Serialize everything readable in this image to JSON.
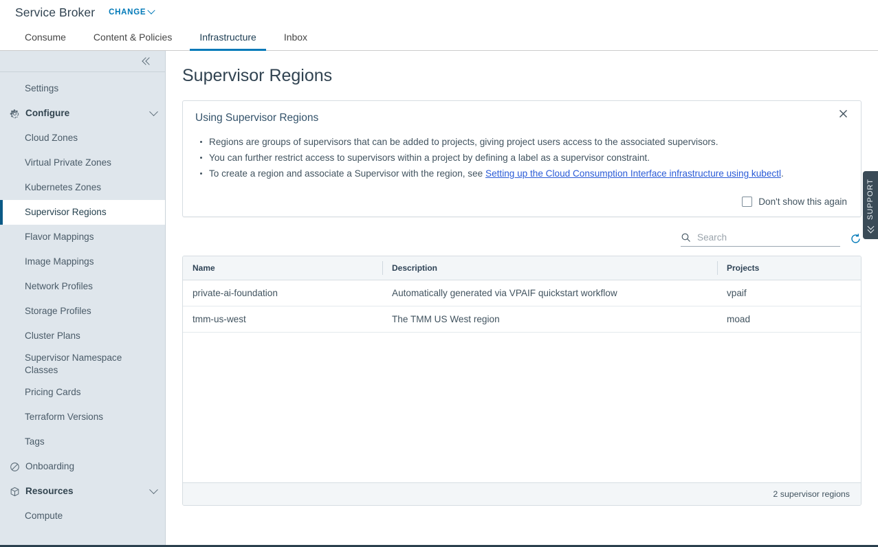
{
  "header": {
    "app_title": "Service Broker",
    "change_label": "CHANGE"
  },
  "tabs": [
    {
      "label": "Consume",
      "active": false
    },
    {
      "label": "Content & Policies",
      "active": false
    },
    {
      "label": "Infrastructure",
      "active": true
    },
    {
      "label": "Inbox",
      "active": false
    }
  ],
  "sidebar": {
    "items": [
      {
        "label": "Settings",
        "type": "link",
        "icon": null
      },
      {
        "label": "Configure",
        "type": "group",
        "icon": "gear-icon",
        "caret": true
      },
      {
        "label": "Cloud Zones",
        "type": "link",
        "icon": null
      },
      {
        "label": "Virtual Private Zones",
        "type": "link",
        "icon": null
      },
      {
        "label": "Kubernetes Zones",
        "type": "link",
        "icon": null
      },
      {
        "label": "Supervisor Regions",
        "type": "link",
        "icon": null,
        "active": true
      },
      {
        "label": "Flavor Mappings",
        "type": "link",
        "icon": null
      },
      {
        "label": "Image Mappings",
        "type": "link",
        "icon": null
      },
      {
        "label": "Network Profiles",
        "type": "link",
        "icon": null
      },
      {
        "label": "Storage Profiles",
        "type": "link",
        "icon": null
      },
      {
        "label": "Cluster Plans",
        "type": "link",
        "icon": null
      },
      {
        "label": "Supervisor Namespace Classes",
        "type": "link",
        "icon": null
      },
      {
        "label": "Pricing Cards",
        "type": "link",
        "icon": null
      },
      {
        "label": "Terraform Versions",
        "type": "link",
        "icon": null
      },
      {
        "label": "Tags",
        "type": "link",
        "icon": null
      },
      {
        "label": "Onboarding",
        "type": "icon-link",
        "icon": "blocked-circle-icon"
      },
      {
        "label": "Resources",
        "type": "group",
        "icon": "cube-icon",
        "caret": true
      },
      {
        "label": "Compute",
        "type": "link",
        "icon": null
      }
    ]
  },
  "page": {
    "title": "Supervisor Regions"
  },
  "info_banner": {
    "title": "Using Supervisor Regions",
    "bullets": [
      "Regions are groups of supervisors that can be added to projects, giving project users access to the associated supervisors.",
      "You can further restrict access to supervisors within a project by defining a label as a supervisor constraint.",
      "To create a region and associate a Supervisor with the region, see "
    ],
    "link_text": "Setting up the Cloud Consumption Interface infrastructure using kubectl",
    "link_suffix": ".",
    "dont_show_label": "Don't show this again"
  },
  "search": {
    "placeholder": "Search",
    "value": ""
  },
  "table": {
    "columns": [
      "Name",
      "Description",
      "Projects"
    ],
    "rows": [
      {
        "name": "private-ai-foundation",
        "description": "Automatically generated via VPAIF quickstart workflow",
        "projects": "vpaif"
      },
      {
        "name": "tmm-us-west",
        "description": "The TMM US West region",
        "projects": "moad"
      }
    ],
    "footer": "2 supervisor regions"
  },
  "support": {
    "label": "SUPPORT"
  },
  "colors": {
    "accent": "#0079b8",
    "active_bar": "#0b5a86",
    "sidebar_bg": "#dfe6ec",
    "link": "#2a5bd7",
    "support_bg": "#3a4b57"
  }
}
